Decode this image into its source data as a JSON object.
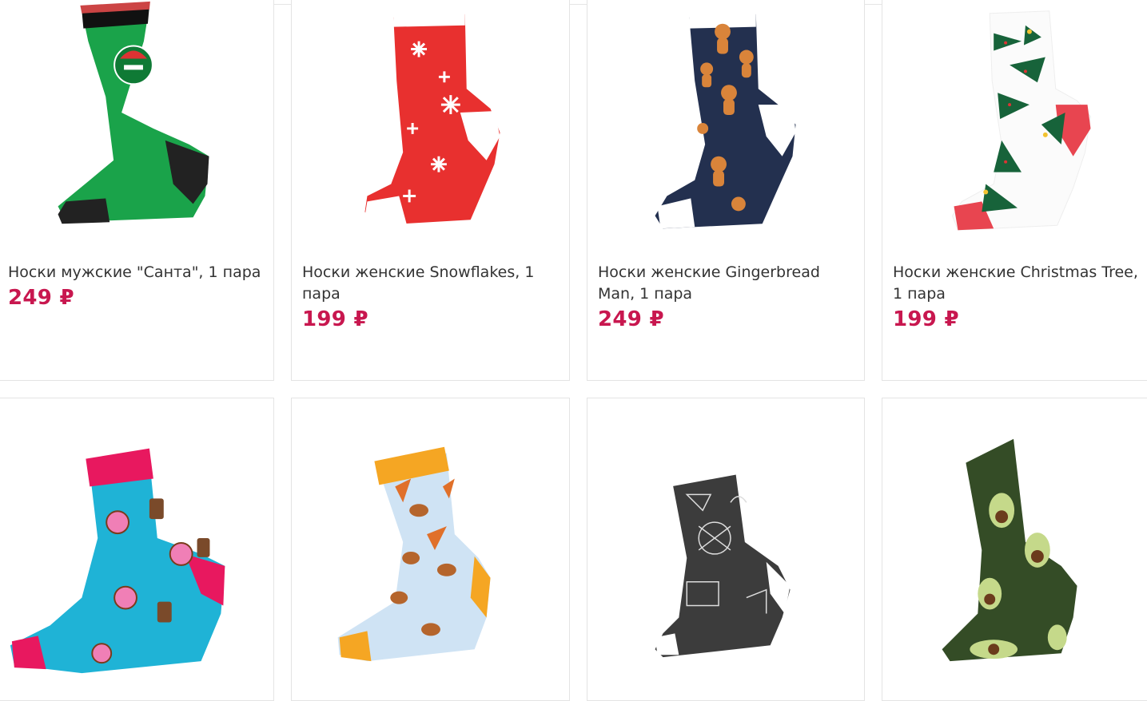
{
  "products": [
    {
      "title": "Носки мужские \"Санта\", 1 пара",
      "price": "249 ₽",
      "image": "sock-santa-green"
    },
    {
      "title": "Носки женские Snowflakes, 1 пара",
      "price": "199 ₽",
      "image": "sock-snowflakes-red"
    },
    {
      "title": "Носки женские Gingerbread Man, 1 пара",
      "price": "249 ₽",
      "image": "sock-gingerbread-navy"
    },
    {
      "title": "Носки женские Christmas Tree, 1 пара",
      "price": "199 ₽",
      "image": "sock-christmas-tree-white"
    },
    {
      "title": "",
      "price": "",
      "image": "sock-donuts-coffee-blue"
    },
    {
      "title": "",
      "price": "",
      "image": "sock-pizza-burger-lightblue"
    },
    {
      "title": "",
      "price": "",
      "image": "sock-math-chalkboard-grey"
    },
    {
      "title": "",
      "price": "",
      "image": "sock-avocado-green"
    }
  ],
  "colors": {
    "price": "#c8174f",
    "text": "#333333",
    "border": "#e4e4e4"
  }
}
